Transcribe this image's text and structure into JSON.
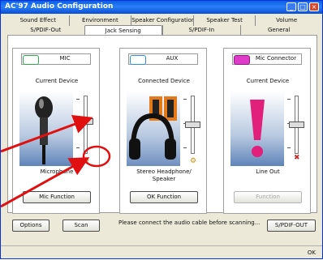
{
  "window": {
    "title": "AC'97 Audio Configuration",
    "min": "_",
    "max": "□",
    "close": "×"
  },
  "tabs_row1": [
    {
      "label": "Sound Effect"
    },
    {
      "label": "Environment"
    },
    {
      "label": "Speaker Configuration"
    },
    {
      "label": "Speaker Test"
    },
    {
      "label": "Volume"
    }
  ],
  "tabs_row2": [
    {
      "label": "S/PDIF-Out"
    },
    {
      "label": "Jack Sensing",
      "active": true
    },
    {
      "label": "S/PDIF-In"
    },
    {
      "label": "General"
    }
  ],
  "panels": [
    {
      "header": "MIC",
      "subtitle": "Current Device",
      "caption": "Microphone",
      "button": "Mic Function",
      "button_disabled": false,
      "jack_color": "#2ea84a"
    },
    {
      "header": "AUX",
      "subtitle": "Connected Device",
      "caption": "Stereo Headphone/\nSpeaker",
      "button": "OK Function",
      "button_disabled": false,
      "jack_color": "#2a8fd8"
    },
    {
      "header": "Mic Connector",
      "subtitle": "Current Device",
      "caption": "Line Out",
      "button": "Function",
      "button_disabled": true,
      "jack_color": "#e03ac8"
    }
  ],
  "footer": {
    "options_button": "Options",
    "scan_button": "Scan",
    "note": "Please connect the audio cable before scanning...",
    "right_button": "S/PDIF-OUT"
  },
  "statusbar": {
    "text": "OK"
  },
  "colors": {
    "annotation_red": "#e01010",
    "titlebar": "#0a5fe6"
  }
}
